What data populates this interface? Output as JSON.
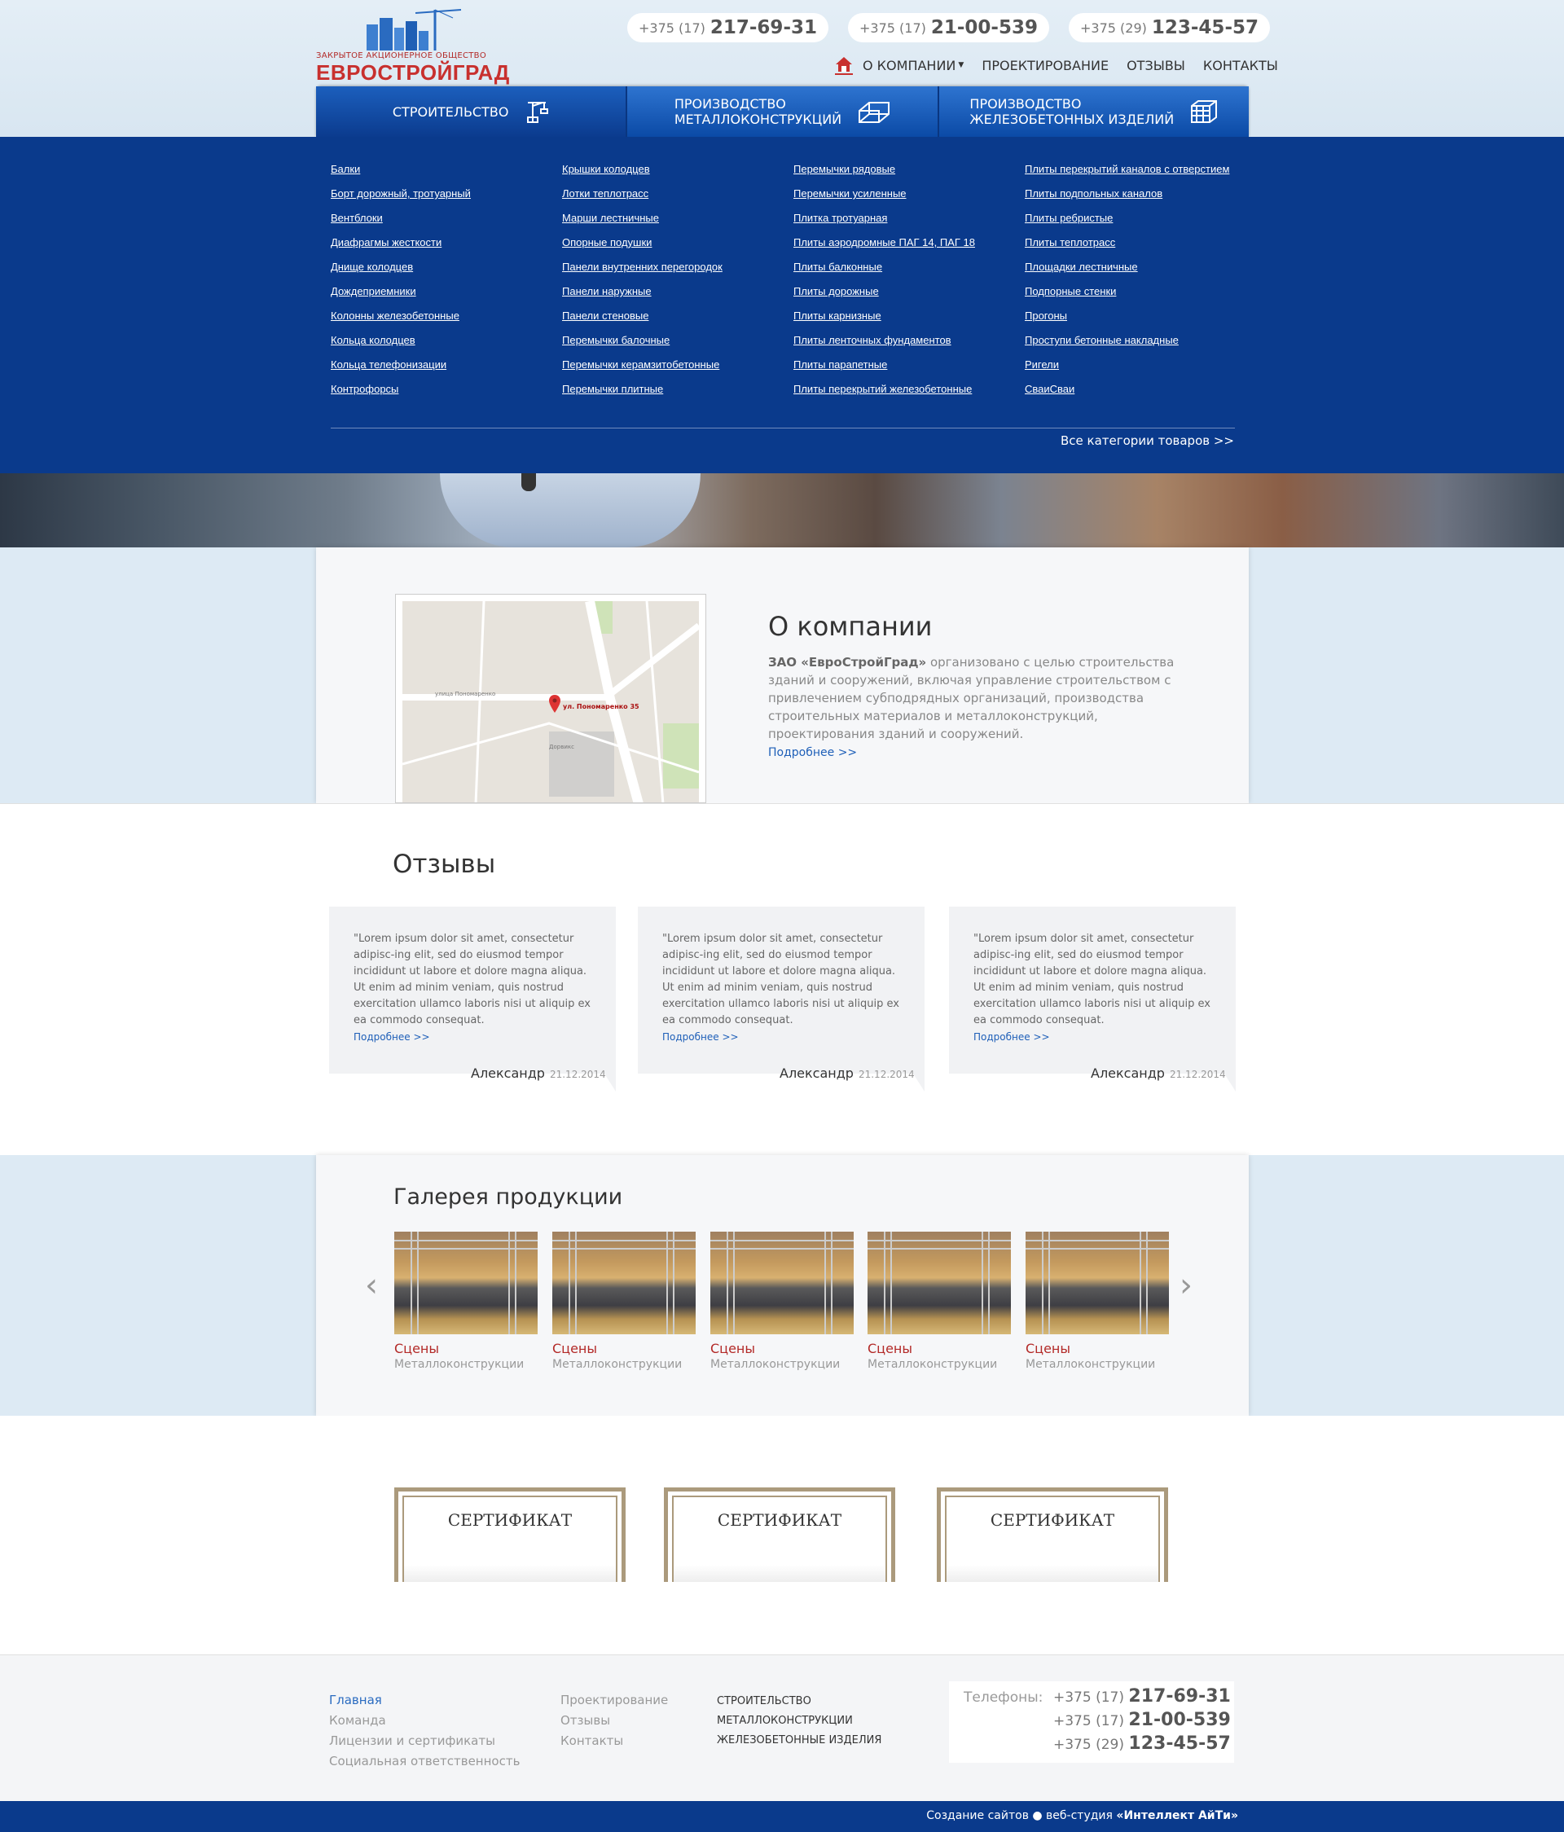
{
  "logo": {
    "subtitle": "ЗАКРЫТОЕ АКЦИОНЕРНОЕ ОБЩЕСТВО",
    "name": "ЕВРОСТРОЙГРАД"
  },
  "phones": [
    {
      "code": "+375 (17)",
      "number": "217-69-31"
    },
    {
      "code": "+375 (17)",
      "number": "21-00-539"
    },
    {
      "code": "+375 (29)",
      "number": "123-45-57"
    }
  ],
  "topnav": {
    "about": "О КОМПАНИИ",
    "design": "ПРОЕКТИРОВАНИЕ",
    "reviews": "ОТЗЫВЫ",
    "contacts": "КОНТАКТЫ"
  },
  "tabs": [
    {
      "line1": "СТРОИТЕЛЬСТВО",
      "line2": ""
    },
    {
      "line1": "ПРОИЗВОДСТВО",
      "line2": "МЕТАЛЛОКОНСТРУКЦИЙ"
    },
    {
      "line1": "ПРОИЗВОДСТВО",
      "line2": "ЖЕЛЕЗОБЕТОННЫХ ИЗДЕЛИЙ"
    }
  ],
  "menu": {
    "col1": [
      "Балки",
      "Борт дорожный, тротуарный",
      "Вентблоки",
      "Диафрагмы жесткости",
      "Днище колодцев",
      "Дождеприемники",
      "Колонны железобетонные",
      "Кольца колодцев",
      "Кольца телефонизации",
      "Контрофорсы"
    ],
    "col2": [
      "Крышки колодцев",
      "Лотки теплотрасс",
      "Марши лестничные",
      "Опорные подушки",
      "Панели внутренних перегородок",
      "Панели наружные",
      "Панели стеновые",
      "Перемычки балочные",
      "Перемычки керамзитобетонные",
      "Перемычки плитные"
    ],
    "col3": [
      "Перемычки рядовые",
      "Перемычки усиленные",
      "Плитка тротуарная",
      "Плиты аэродромные ПАГ 14, ПАГ 18",
      "Плиты балконные",
      "Плиты дорожные",
      "Плиты карнизные",
      "Плиты ленточных фундаментов",
      "Плиты парапетные",
      "Плиты перекрытий железобетонные "
    ],
    "col4": [
      "Плиты перекрытий каналов с отверстием",
      "Плиты подпольных каналов",
      "Плиты ребристые",
      "Плиты теплотрасс",
      "Площадки лестничные",
      "Подпорные стенки",
      "Прогоны",
      "Проступи бетонные накладные",
      "Ригели",
      "СваиСваи"
    ],
    "all": "Все категории товаров >>"
  },
  "about": {
    "title": "О компании",
    "company": "ЗАО «ЕвроСтройГрад»",
    "text": " организовано с целью строительства зданий и сооружений, включая управление строительством с привлечением субподрядных организаций, производства строительных материалов и металлоконструкций, проектирования зданий и сооружений.",
    "more": "Подробнее >>",
    "map_label": "ул. Пономаренко 35",
    "map_streets": [
      "улица Пономаренко",
      "Дорвикс"
    ]
  },
  "reviews": {
    "title": "Отзывы",
    "items": [
      {
        "text": "\"Lorem ipsum dolor sit amet, consectetur adipisc-ing elit, sed do eiusmod tempor incididunt ut labore et dolore magna aliqua. Ut enim ad minim veniam, quis nostrud exercitation ullamco laboris nisi ut aliquip ex ea commodo consequat.",
        "more": "Подробнее >>",
        "author": "Александр",
        "date": "21.12.2014"
      },
      {
        "text": "\"Lorem ipsum dolor sit amet, consectetur adipisc-ing elit, sed do eiusmod tempor incididunt ut labore et dolore magna aliqua. Ut enim ad minim veniam, quis nostrud exercitation ullamco laboris nisi ut aliquip ex ea commodo consequat.",
        "more": "Подробнее >>",
        "author": "Александр",
        "date": "21.12.2014"
      },
      {
        "text": "\"Lorem ipsum dolor sit amet, consectetur adipisc-ing elit, sed do eiusmod tempor incididunt ut labore et dolore magna aliqua. Ut enim ad minim veniam, quis nostrud exercitation ullamco laboris nisi ut aliquip ex ea commodo consequat.",
        "more": "Подробнее >>",
        "author": "Александр",
        "date": "21.12.2014"
      }
    ]
  },
  "gallery": {
    "title": "Галерея продукции",
    "items": [
      {
        "name": "Сцены",
        "category": "Металлоконструкции"
      },
      {
        "name": "Сцены",
        "category": "Металлоконструкции"
      },
      {
        "name": "Сцены",
        "category": "Металлоконструкции"
      },
      {
        "name": "Сцены",
        "category": "Металлоконструкции"
      },
      {
        "name": "Сцены",
        "category": "Металлоконструкции"
      }
    ],
    "prev_icon": "chevron-left-icon",
    "next_icon": "chevron-right-icon"
  },
  "certificates": [
    "СЕРТИФИКАТ",
    "СЕРТИФИКАТ",
    "СЕРТИФИКАТ"
  ],
  "footer": {
    "col1": [
      "Главная",
      "Команда",
      "Лицензии и сертификаты",
      "Социальная ответственность"
    ],
    "col2": [
      "Проектирование",
      "Отзывы",
      "Контакты"
    ],
    "col3": [
      "СТРОИТЕЛЬСТВО",
      "МЕТАЛЛОКОНСТРУКЦИИ",
      "ЖЕЛЕЗОБЕТОННЫЕ ИЗДЕЛИЯ"
    ],
    "phones_label": "Телефоны:",
    "credit_prefix": "Создание сайтов ● веб-студия ",
    "credit_name": "«Интеллект АйТи»"
  },
  "colors": {
    "brand_blue": "#0a3a8c",
    "accent_red": "#c8302e",
    "link_blue": "#1e5fb8"
  }
}
